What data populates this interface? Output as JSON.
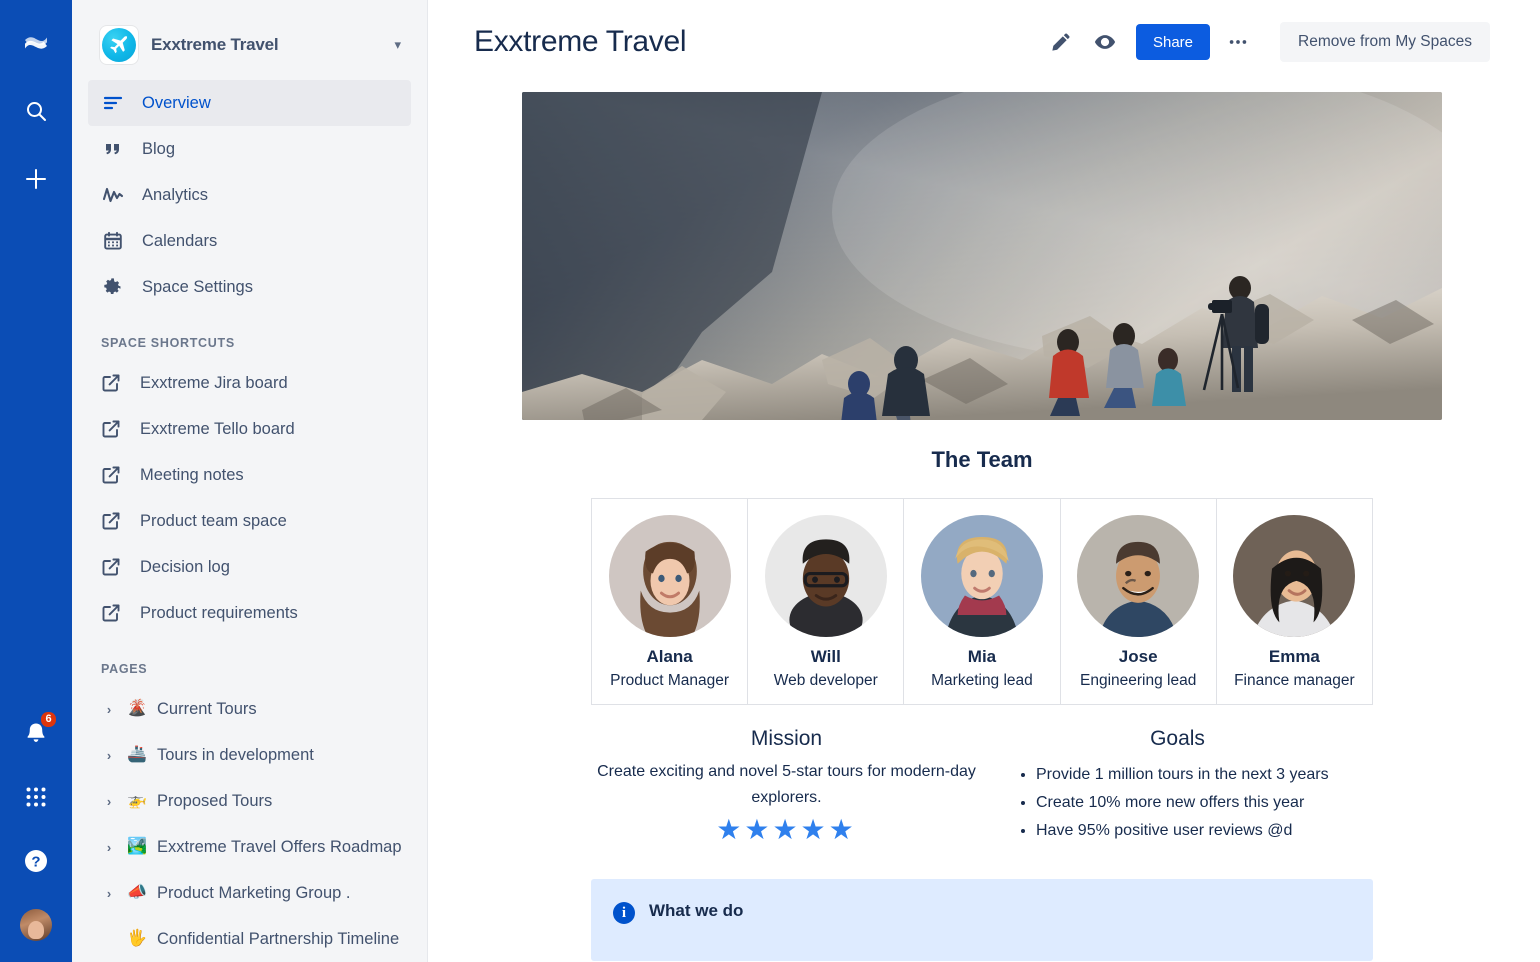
{
  "rail": {
    "logo_icon": "confluence-logo-icon",
    "search_icon": "search-icon",
    "create_icon": "plus-icon",
    "notifications_icon": "bell-icon",
    "notifications_count": "6",
    "apps_icon": "app-switcher-icon",
    "help_icon": "help-icon",
    "profile_icon": "profile-avatar"
  },
  "sidebar": {
    "space_name": "Exxtreme Travel",
    "space_logo_icon": "travel-plane-logo",
    "chevron_icon": "chevron-down-icon",
    "nav": [
      {
        "label": "Overview",
        "icon": "overview-icon",
        "active": true
      },
      {
        "label": "Blog",
        "icon": "quote-icon",
        "active": false
      },
      {
        "label": "Analytics",
        "icon": "analytics-icon",
        "active": false
      },
      {
        "label": "Calendars",
        "icon": "calendar-icon",
        "active": false
      },
      {
        "label": "Space Settings",
        "icon": "gear-icon",
        "active": false
      }
    ],
    "shortcuts_title": "SPACE SHORTCUTS",
    "shortcuts": [
      {
        "label": "Exxtreme Jira board",
        "icon": "external-link-icon"
      },
      {
        "label": "Exxtreme Tello board",
        "icon": "external-link-icon"
      },
      {
        "label": "Meeting notes",
        "icon": "external-link-icon"
      },
      {
        "label": "Product team space",
        "icon": "external-link-icon"
      },
      {
        "label": "Decision log",
        "icon": "external-link-icon"
      },
      {
        "label": "Product requirements",
        "icon": "external-link-icon"
      }
    ],
    "pages_title": "PAGES",
    "pages": [
      {
        "label": "Current Tours",
        "emoji": "🌋",
        "chevron": "›"
      },
      {
        "label": "Tours in development",
        "emoji": "🚢",
        "chevron": "›"
      },
      {
        "label": "Proposed Tours",
        "emoji": "🚁",
        "chevron": "›"
      },
      {
        "label": "Exxtreme Travel Offers Roadmap",
        "emoji": "🏞️",
        "chevron": "›"
      },
      {
        "label": "Product Marketing Group .",
        "emoji": "📣",
        "chevron": "›"
      },
      {
        "label": "Confidential Partnership Timeline",
        "emoji": "🖐️",
        "chevron": "›"
      }
    ]
  },
  "header": {
    "title": "Exxtreme Travel",
    "edit_icon": "pencil-icon",
    "watch_icon": "eye-icon",
    "share_label": "Share",
    "more_label": "•••",
    "remove_label": "Remove from My Spaces"
  },
  "main": {
    "hero_alt": "hikers-on-rocky-cliff-photo",
    "team_heading": "The Team",
    "team": [
      {
        "name": "Alana",
        "role": "Product Manager"
      },
      {
        "name": "Will",
        "role": "Web developer"
      },
      {
        "name": "Mia",
        "role": "Marketing lead"
      },
      {
        "name": "Jose",
        "role": "Engineering lead"
      },
      {
        "name": "Emma",
        "role": "Finance manager"
      }
    ],
    "mission_heading": "Mission",
    "mission_text": "Create exciting and novel 5-star tours for modern-day explorers.",
    "mission_stars": "★★★★★",
    "goals_heading": "Goals",
    "goals": [
      "Provide 1 million tours in the next 3 years",
      "Create 10% more new offers this year",
      "Have 95% positive user reviews @d"
    ],
    "info_panel_title": "What we do",
    "info_panel_icon": "info-icon",
    "info_panel_body": ""
  },
  "colors": {
    "rail_blue": "#0B4DB5",
    "sidebar_gray": "#F4F5F7",
    "accent_blue": "#0C5CE0",
    "link_blue": "#0052CC",
    "text_dark": "#172B4D",
    "text_muted": "#42526E",
    "badge_red": "#DE350B",
    "star_blue": "#2F80ED",
    "panel_blue": "#DEEBFF"
  }
}
